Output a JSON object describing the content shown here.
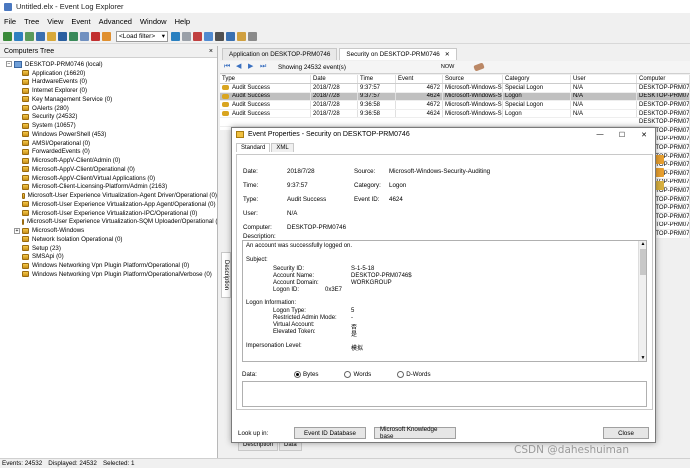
{
  "window": {
    "title": "Untitled.elx - Event Log Explorer"
  },
  "menu": [
    "File",
    "Tree",
    "View",
    "Event",
    "Advanced",
    "Window",
    "Help"
  ],
  "toolbar": {
    "filter_value": "<Load filter>"
  },
  "computers_tree": {
    "header": "Computers Tree",
    "close": "×",
    "root": "DESKTOP-PRM0746 (local)",
    "items": [
      {
        "label": "Application (16620)",
        "expandable": false
      },
      {
        "label": "HardwareEvents (0)",
        "expandable": false
      },
      {
        "label": "Internet Explorer (0)",
        "expandable": false
      },
      {
        "label": "Key Management Service (0)",
        "expandable": false
      },
      {
        "label": "OAlerts (280)",
        "expandable": false
      },
      {
        "label": "Security (24532)",
        "expandable": false
      },
      {
        "label": "System (10657)",
        "expandable": false
      },
      {
        "label": "Windows PowerShell (453)",
        "expandable": false
      },
      {
        "label": "AMSI/Operational (0)",
        "expandable": false
      },
      {
        "label": "ForwardedEvents (0)",
        "expandable": false
      },
      {
        "label": "Microsoft-AppV-Client/Admin (0)",
        "expandable": false
      },
      {
        "label": "Microsoft-AppV-Client/Operational (0)",
        "expandable": false
      },
      {
        "label": "Microsoft-AppV-Client/Virtual Applications (0)",
        "expandable": false
      },
      {
        "label": "Microsoft-Client-Licensing-Platform/Admin (2163)",
        "expandable": false
      },
      {
        "label": "Microsoft-User Experience Virtualization-Agent Driver/Operational (0)",
        "expandable": false
      },
      {
        "label": "Microsoft-User Experience Virtualization-App Agent/Operational (0)",
        "expandable": false
      },
      {
        "label": "Microsoft-User Experience Virtualization-IPC/Operational (0)",
        "expandable": false
      },
      {
        "label": "Microsoft-User Experience Virtualization-SQM Uploader/Operational (0)",
        "expandable": false
      },
      {
        "label": "Microsoft-Windows",
        "expandable": true
      },
      {
        "label": "Network Isolation Operational (0)",
        "expandable": false
      },
      {
        "label": "Setup (23)",
        "expandable": false
      },
      {
        "label": "SMSApi (0)",
        "expandable": false
      },
      {
        "label": "Windows Networking Vpn Plugin Platform/Operational (0)",
        "expandable": false
      },
      {
        "label": "Windows Networking Vpn Plugin Platform/OperationalVerbose (0)",
        "expandable": false
      }
    ]
  },
  "tabs": [
    {
      "label": "Application on DESKTOP-PRM0746",
      "active": false
    },
    {
      "label": "Security on DESKTOP-PRM0746",
      "active": true
    }
  ],
  "events_toolbar": {
    "count_text": "Showing 24532 event(s)",
    "now_label": "NOW"
  },
  "grid": {
    "columns": [
      "Type",
      "Date",
      "Time",
      "Event",
      "Source",
      "Category",
      "User",
      "Computer"
    ],
    "rows": [
      {
        "type": "Audit Success",
        "date": "2018/7/28",
        "time": "9:37:57",
        "event": "4672",
        "source": "Microsoft-Windows-Se",
        "category": "Special Logon",
        "user": "N/A",
        "computer": "DESKTOP-PRM0746",
        "selected": false
      },
      {
        "type": "Audit Success",
        "date": "2018/7/28",
        "time": "9:37:57",
        "event": "4624",
        "source": "Microsoft-Windows-Se",
        "category": "Logon",
        "user": "N/A",
        "computer": "DESKTOP-PRM0746",
        "selected": true
      },
      {
        "type": "Audit Success",
        "date": "2018/7/28",
        "time": "9:36:58",
        "event": "4672",
        "source": "Microsoft-Windows-Se",
        "category": "Special Logon",
        "user": "N/A",
        "computer": "DESKTOP-PRM0746",
        "selected": false
      },
      {
        "type": "Audit Success",
        "date": "2018/7/28",
        "time": "9:36:58",
        "event": "4624",
        "source": "Microsoft-Windows-Se",
        "category": "Logon",
        "user": "N/A",
        "computer": "DESKTOP-PRM0746",
        "selected": false
      }
    ],
    "partial_computers": [
      "DESKTOP-PRM0746",
      "DESKTOP-PRM0746",
      "DESKTOP-PRM0746",
      "DESKTOP-PRM0746",
      "DESKTOP-PRM0746",
      "DESKTOP-PRM0746",
      "DESKTOP-PRM0746",
      "DESKTOP-PRM0746",
      "DESKTOP-PRM0746",
      "DESKTOP-PRM0746",
      "DESKTOP-PRM0746",
      "DESKTOP-PRM0746",
      "DESKTOP-PRM0746",
      "DESKTOP-PRM0746"
    ]
  },
  "side_tabs": {
    "description": "Description"
  },
  "bottom_tabs": [
    "Description",
    "Data"
  ],
  "statusbar": {
    "events": "Events: 24532",
    "displayed": "Displayed: 24532",
    "selected": "Selected: 1"
  },
  "dialog": {
    "title": "Event Properties - Security on DESKTOP-PRM0746",
    "tabs": [
      "Standard",
      "XML"
    ],
    "labels": {
      "date": "Date:",
      "time": "Time:",
      "type": "Type:",
      "user": "User:",
      "computer": "Computer:",
      "source": "Source:",
      "category": "Category:",
      "event_id": "Event ID:",
      "description": "Description:",
      "data": "Data:"
    },
    "values": {
      "date": "2018/7/28",
      "time": "9:37:57",
      "type": "Audit Success",
      "user": "N/A",
      "computer": "DESKTOP-PRM0746",
      "source": "Microsoft-Windows-Security-Auditing",
      "category": "Logon",
      "event_id": "4624"
    },
    "message": {
      "line1": "An account was successfully logged on.",
      "subject": "Subject:",
      "fields": [
        {
          "label": "Security ID:",
          "value": "S-1-5-18"
        },
        {
          "label": "Account Name:",
          "value": "DESKTOP-PRM0746$"
        },
        {
          "label": "Account Domain:",
          "value": "WORKGROUP"
        },
        {
          "label": "Logon ID:",
          "value": "0x3E7"
        }
      ],
      "logon_info": "Logon Information:",
      "logon_fields": [
        {
          "label": "Logon Type:",
          "value": "5"
        },
        {
          "label": "Restricted Admin Mode:",
          "value": "-"
        },
        {
          "label": "Virtual Account:",
          "value": "否"
        },
        {
          "label": "Elevated Token:",
          "value": "是"
        }
      ],
      "impersonation_label": "Impersonation Level:",
      "impersonation_value": "模拟"
    },
    "data_options": [
      "Bytes",
      "Words",
      "D-Words"
    ],
    "selected_option": "Bytes",
    "lookup_label": "Look up in:",
    "btn_event_db": "Event ID Database",
    "btn_kb": "Microsoft Knowledge base",
    "btn_close": "Close"
  },
  "watermark": "CSDN @daheshuiman"
}
